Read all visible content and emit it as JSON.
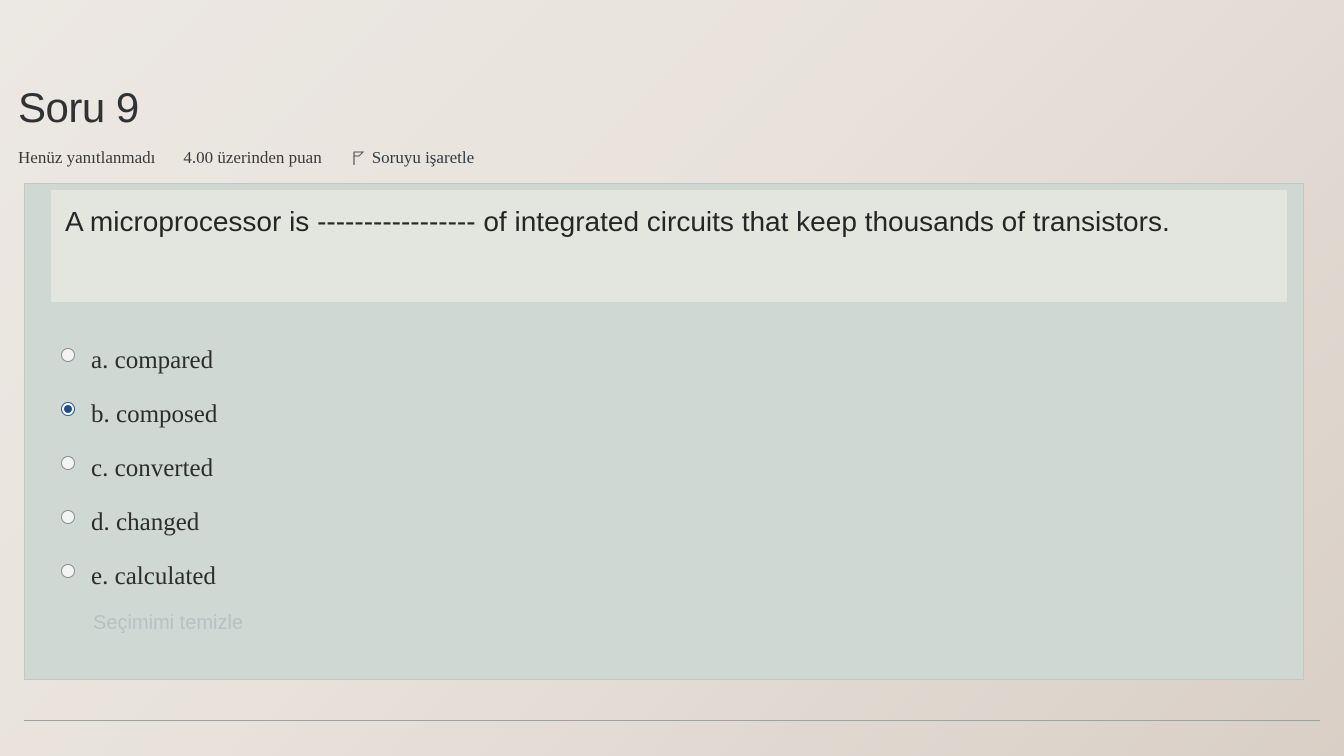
{
  "question": {
    "title": "Soru 9",
    "state": "Henüz yanıtlanmadı",
    "grade": "4.00 üzerinden puan",
    "flag_label": "Soruyu işaretle",
    "text": "A microprocessor is ----------------- of integrated circuits that keep thousands of transistors."
  },
  "answers": [
    {
      "label": "a. compared",
      "selected": false
    },
    {
      "label": "b. composed",
      "selected": true
    },
    {
      "label": "c. converted",
      "selected": false
    },
    {
      "label": "d. changed",
      "selected": false
    },
    {
      "label": "e. calculated",
      "selected": false
    }
  ],
  "clear_choice_label": "Seçimimi temizle",
  "icons": {
    "flag": "flag-icon",
    "radio": "radio-button-icon"
  }
}
